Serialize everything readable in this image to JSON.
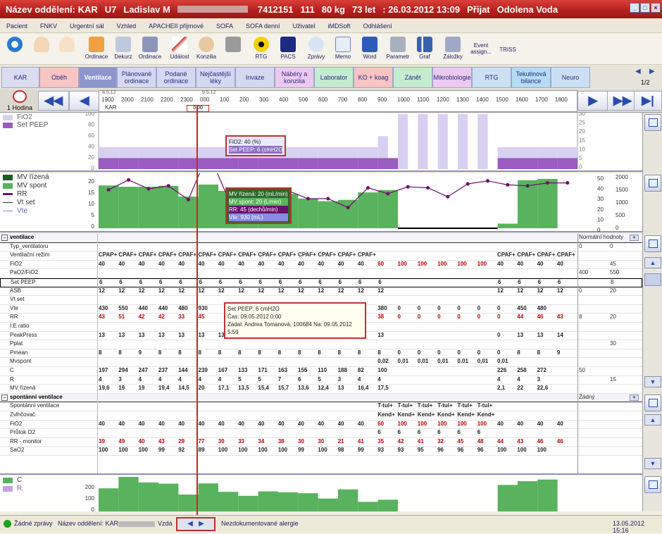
{
  "title": {
    "dept": "Název oddělení: KAR",
    "bed": "U7",
    "patient": "Ladislav M",
    "pid": "7412151",
    "num": "111",
    "weight": "80 kg",
    "age": "73 let",
    "admit": ": 26.03.2012 13:09",
    "admit_label": "Přijat",
    "doctor": "Odolena Voda"
  },
  "menu": [
    "Pacient",
    "FNKV",
    "Urgentní sál",
    "Vzhled",
    "APACHEII přijmové",
    "SOFA",
    "SOFA denní",
    "Uživatel",
    "iMDSoft",
    "Odhlášení"
  ],
  "toolbar": [
    "",
    "",
    "",
    "Ordinace",
    "Dekurz",
    "Ordinace",
    "Událost",
    "Konzilia",
    "",
    "RTG",
    "PACS",
    "Zprávy",
    "Memo",
    "Word",
    "Parametr",
    "Graf",
    "Záložky",
    "Event assign...",
    "TRISS"
  ],
  "tabs": [
    "KAR",
    "Oběh",
    "Ventilace",
    "Plánované ordinace",
    "Podané ordinace",
    "Nejčastější léky",
    "Invaze",
    "Nábéry a konzilia",
    "Laborator",
    "KO + koag",
    "Zánět",
    "Mikrobiologie",
    "RTG",
    "Tekutinová bilance",
    "Neuro"
  ],
  "tabs_page": "1/2",
  "time": {
    "interval": "1 Hodina",
    "date1": "8.5.12",
    "date2": "9.5.12",
    "kar": "KAR",
    "marker": "0:00",
    "ticks": [
      "1900",
      "2000",
      "2100",
      "2200",
      "2300",
      "000",
      "100",
      "200",
      "300",
      "400",
      "500",
      "600",
      "700",
      "800",
      "900",
      "1000",
      "1100",
      "1200",
      "1300",
      "1400",
      "1500",
      "1600",
      "1700",
      "1800"
    ]
  },
  "panel1": {
    "legend": [
      "FiO2",
      "Set PEEP"
    ],
    "left_axis": [
      "100",
      "80",
      "60",
      "40",
      "20",
      "0"
    ],
    "right_axis": [
      "30",
      "25",
      "20",
      "15",
      "10",
      "5",
      "0"
    ],
    "tooltip": [
      "FiO2: 40 (%)",
      "Set PEEP: 6 (cmH2O"
    ]
  },
  "panel2": {
    "legend": [
      "MV řízená",
      "MV spont",
      "RR",
      "Vt set",
      "Vte"
    ],
    "left_axis": [
      "20",
      "15",
      "10",
      "5",
      "0"
    ],
    "right_axis1": [
      "50",
      "40",
      "30",
      "20",
      "10",
      "0"
    ],
    "right_axis2": [
      "2000",
      "1500",
      "1000",
      "500",
      "0"
    ],
    "tooltip": [
      "MV řízená: 20 (mL/min)",
      "MV spont: 20 (L/min)",
      "RR: 45 (dechů/min)",
      "Vte: 930 (mL)"
    ]
  },
  "grid": {
    "section1": "ventilace",
    "section1_right": "Normální hodnoty",
    "section2": "spontánní ventilace",
    "section2_right": "Žádný",
    "rows1": [
      {
        "label": "Typ_ventilatoru",
        "cells": [
          "",
          "",
          "",
          "",
          "",
          "",
          "",
          "",
          "",
          "",
          "",
          "",
          "",
          "",
          "",
          "",
          "",
          "",
          "",
          "",
          "",
          "",
          "",
          "",
          ""
        ],
        "r1": "0",
        "r2": "0"
      },
      {
        "label": "Ventilační režim",
        "cells": [
          "CPAP+",
          "CPAF+",
          "CPAF+",
          "CPAF+",
          "CPAF+",
          "CPAF+",
          "CPAF+",
          "CPAF+",
          "CPAF+",
          "CPAF+",
          "CPAF+",
          "CPAF+",
          "CPAF+",
          "CPAF+",
          "",
          "",
          "",
          "",
          "",
          "",
          "CPAF+",
          "CPAF+",
          "CPAF+",
          "CPAF+",
          ""
        ],
        "r1": "",
        "r2": ""
      },
      {
        "label": "FiO2",
        "cells": [
          "40",
          "40",
          "40",
          "40",
          "40",
          "40",
          "40",
          "40",
          "40",
          "40",
          "40",
          "40",
          "40",
          "40",
          "60",
          "100",
          "100",
          "100",
          "100",
          "100",
          "40",
          "40",
          "40",
          "40",
          ""
        ],
        "r1": "",
        "r2": "45"
      },
      {
        "label": "PaO2/FiO2",
        "cells": [
          "",
          "",
          "",
          "",
          "",
          "",
          "",
          "",
          "",
          "",
          "",
          "",
          "",
          "",
          "",
          "",
          "",
          "",
          "",
          "",
          "",
          "",
          "",
          "",
          ""
        ],
        "r1": "400",
        "r2": "550"
      },
      {
        "label": "Set PEEP",
        "cells": [
          "6",
          "6",
          "6",
          "6",
          "6",
          "6",
          "6",
          "6",
          "6",
          "6",
          "6",
          "6",
          "6",
          "6",
          "6",
          "",
          "",
          "",
          "",
          "",
          "6",
          "6",
          "6",
          "6",
          ""
        ],
        "r1": "",
        "r2": "8"
      },
      {
        "label": "ASB",
        "cells": [
          "12",
          "12",
          "12",
          "12",
          "12",
          "12",
          "12",
          "12",
          "12",
          "12",
          "12",
          "12",
          "12",
          "12",
          "12",
          "",
          "",
          "",
          "",
          "",
          "12",
          "12",
          "12",
          "12",
          ""
        ],
        "r1": "0",
        "r2": "20"
      },
      {
        "label": "Vt set",
        "cells": [
          "",
          "",
          "",
          "",
          "",
          "",
          "",
          "",
          "",
          "",
          "",
          "",
          "",
          "",
          "",
          "",
          "",
          "",
          "",
          "",
          "",
          "",
          "",
          "",
          ""
        ],
        "r1": "",
        "r2": ""
      },
      {
        "label": "Vte",
        "cells": [
          "430",
          "550",
          "440",
          "440",
          "480",
          "930",
          "",
          "",
          "",
          "",
          "",
          "",
          "",
          "",
          "380",
          "0",
          "0",
          "0",
          "0",
          "0",
          "0",
          "450",
          "480",
          "",
          ""
        ],
        "r1": "",
        "r2": ""
      },
      {
        "label": "RR",
        "cells": [
          "43",
          "51",
          "42",
          "42",
          "33",
          "45",
          "",
          "",
          "",
          "",
          "",
          "",
          "",
          "",
          "38",
          "0",
          "0",
          "0",
          "0",
          "0",
          "0",
          "44",
          "46",
          "43",
          ""
        ],
        "r1": "8",
        "r2": "20"
      },
      {
        "label": "I:E ratio",
        "cells": [
          "",
          "",
          "",
          "",
          "",
          "",
          "",
          "",
          "",
          "",
          "",
          "",
          "",
          "",
          "",
          "",
          "",
          "",
          "",
          "",
          "",
          "",
          "",
          "",
          ""
        ],
        "r1": "",
        "r2": ""
      },
      {
        "label": "PeakPress",
        "cells": [
          "13",
          "13",
          "13",
          "13",
          "13",
          "13",
          "13",
          "13",
          "13",
          "13",
          "13",
          "13",
          "13",
          "13",
          "13",
          "",
          "",
          "",
          "",
          "",
          "0",
          "13",
          "13",
          "14",
          ""
        ],
        "r1": "",
        "r2": ""
      },
      {
        "label": "Pplat",
        "cells": [
          "",
          "",
          "",
          "",
          "",
          "",
          "",
          "",
          "",
          "",
          "",
          "",
          "",
          "",
          "",
          "",
          "",
          "",
          "",
          "",
          "",
          "",
          "",
          "",
          ""
        ],
        "r1": "",
        "r2": "30"
      },
      {
        "label": "Pmean",
        "cells": [
          "8",
          "8",
          "9",
          "8",
          "8",
          "8",
          "8",
          "8",
          "8",
          "8",
          "8",
          "8",
          "8",
          "8",
          "8",
          "0",
          "0",
          "0",
          "0",
          "0",
          "0",
          "8",
          "8",
          "9",
          ""
        ],
        "r1": "",
        "r2": ""
      },
      {
        "label": "Mvspont",
        "cells": [
          "",
          "",
          "",
          "",
          "",
          "",
          "",
          "",
          "",
          "",
          "",
          "",
          "",
          "",
          "0,02",
          "0,01",
          "0,01",
          "0,01",
          "0,01",
          "0,01",
          "0,01",
          "",
          "",
          "",
          ""
        ],
        "r1": "",
        "r2": ""
      },
      {
        "label": "C",
        "cells": [
          "197",
          "294",
          "247",
          "237",
          "144",
          "239",
          "167",
          "133",
          "171",
          "163",
          "155",
          "110",
          "188",
          "82",
          "100",
          "",
          "",
          "",
          "",
          "",
          "226",
          "258",
          "272",
          "",
          ""
        ],
        "r1": "50",
        "r2": ""
      },
      {
        "label": "R",
        "cells": [
          "4",
          "3",
          "4",
          "4",
          "4",
          "4",
          "4",
          "5",
          "5",
          "7",
          "6",
          "5",
          "3",
          "4",
          "4",
          "",
          "",
          "",
          "",
          "",
          "4",
          "4",
          "3",
          "",
          ""
        ],
        "r1": "",
        "r2": "15"
      },
      {
        "label": "MV řízená",
        "cells": [
          "19,6",
          "19",
          "19",
          "19,4",
          "14,5",
          "20",
          "17,1",
          "13,5",
          "15,4",
          "15,7",
          "13,6",
          "12,4",
          "13",
          "16,4",
          "17,5",
          "",
          "",
          "",
          "",
          "",
          "2,1",
          "22",
          "22,6",
          "",
          ""
        ],
        "r1": "",
        "r2": ""
      }
    ],
    "rows2": [
      {
        "label": "Spontánní ventilace",
        "cells": [
          "",
          "",
          "",
          "",
          "",
          "",
          "",
          "",
          "",
          "",
          "",
          "",
          "",
          "",
          "T-tul+",
          "T-tul+",
          "T-tul+",
          "T-tul+",
          "T-tul+",
          "T-tul+",
          "",
          "",
          "",
          "",
          ""
        ]
      },
      {
        "label": "Zvlhčovač",
        "cells": [
          "",
          "",
          "",
          "",
          "",
          "",
          "",
          "",
          "",
          "",
          "",
          "",
          "",
          "",
          "Kend+",
          "Kend+",
          "Kend+",
          "Kend+",
          "Kend+",
          "Kend+",
          "",
          "",
          "",
          "",
          ""
        ]
      },
      {
        "label": "FiO2",
        "cells": [
          "40",
          "40",
          "40",
          "40",
          "40",
          "40",
          "40",
          "40",
          "40",
          "40",
          "40",
          "40",
          "40",
          "40",
          "60",
          "100",
          "100",
          "100",
          "100",
          "100",
          "40",
          "40",
          "40",
          "40",
          ""
        ]
      },
      {
        "label": "Průtok O2",
        "cells": [
          "",
          "",
          "",
          "",
          "",
          "",
          "",
          "",
          "",
          "",
          "",
          "",
          "",
          "",
          "6",
          "6",
          "6",
          "6",
          "6",
          "6",
          "",
          "",
          "",
          "",
          ""
        ]
      },
      {
        "label": "RR - monitor",
        "cells": [
          "39",
          "49",
          "40",
          "43",
          "29",
          "77",
          "30",
          "33",
          "34",
          "38",
          "30",
          "30",
          "21",
          "41",
          "35",
          "42",
          "41",
          "32",
          "45",
          "48",
          "44",
          "43",
          "46",
          "46",
          ""
        ]
      },
      {
        "label": "SaO2",
        "cells": [
          "100",
          "100",
          "100",
          "99",
          "92",
          "89",
          "100",
          "100",
          "100",
          "100",
          "99",
          "100",
          "98",
          "99",
          "93",
          "93",
          "95",
          "96",
          "96",
          "96",
          "100",
          "100",
          "100",
          "",
          ""
        ]
      }
    ],
    "cell_tooltip": [
      "Set PEEP: 6 cmH2O",
      "Čas: 09.05.2012 0:00",
      "Zadal: Andrea Tomanová, 100684 Na: 09.05.2012 5:59"
    ]
  },
  "panel3": {
    "legend": [
      "C",
      "R"
    ],
    "axis": [
      "200",
      "100",
      "0"
    ]
  },
  "status": {
    "messages": "Žádné zprávy",
    "dept": "Název oddělení: KAR",
    "user_label": "Vzdá",
    "allergy": "Nezdokumentované alergie",
    "datetime": "13.05.2012 15:16"
  },
  "colors": {
    "title_bg": "#b41f1c",
    "accent": "#2a4bb0",
    "fio2": "#d8d0f0",
    "peep": "#9a5cc0",
    "mv": "#59b25d",
    "rr": "#6a0f6e",
    "red": "#c00000"
  }
}
